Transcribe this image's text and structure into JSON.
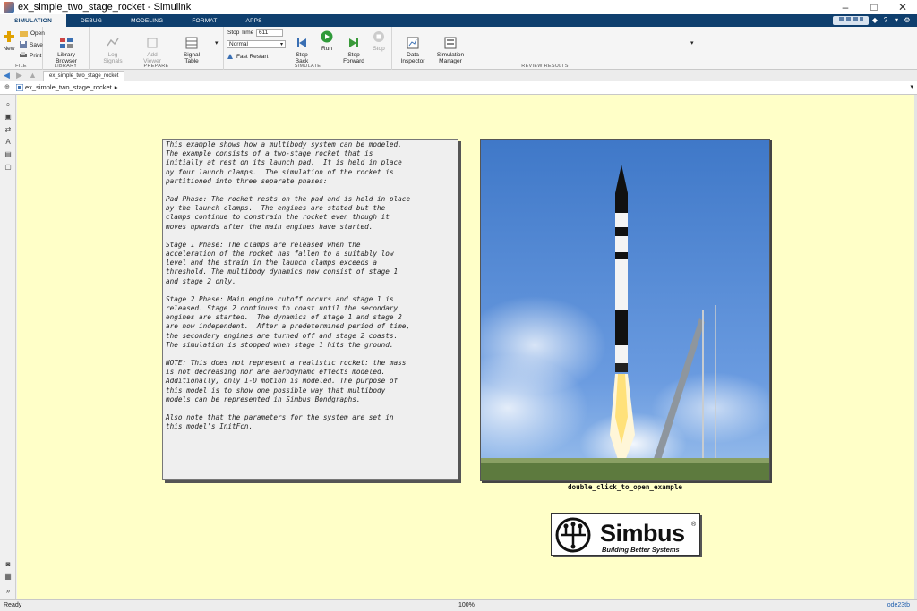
{
  "window": {
    "title": "ex_simple_two_stage_rocket - Simulink",
    "controls": [
      "–",
      "□",
      "✕"
    ]
  },
  "ribbon_tabs": [
    "SIMULATION",
    "DEBUG",
    "MODELING",
    "FORMAT",
    "APPS"
  ],
  "quick_access": {
    "search_label": "",
    "buttons": [
      "◆",
      "?",
      "▾",
      "⚙"
    ]
  },
  "ribbon": {
    "file": {
      "label": "FILE",
      "new_label": "New",
      "open_label": "Open",
      "save_label": "Save",
      "print_label": "Print"
    },
    "library": {
      "label": "LIBRARY",
      "library_browser_label": "Library\nBrowser"
    },
    "prepare": {
      "label": "PREPARE",
      "log_signals_label": "Log\nSignals",
      "add_viewer_label": "Add\nViewer",
      "signal_table_label": "Signal\nTable"
    },
    "simulate": {
      "label": "SIMULATE",
      "stop_time_label": "Stop Time",
      "stop_time_value": "611",
      "mode_value": "Normal",
      "fast_restart_label": "Fast Restart",
      "step_back_label": "Step\nBack",
      "run_label": "Run",
      "step_forward_label": "Step\nForward",
      "stop_label": "Stop"
    },
    "review": {
      "label": "REVIEW RESULTS",
      "data_inspector_label": "Data\nInspector",
      "sim_manager_label": "Simulation\nManager"
    }
  },
  "document_tab": "ex_simple_two_stage_rocket",
  "address": {
    "model_name": "ex_simple_two_stage_rocket",
    "arrow": "▸"
  },
  "annotation_paragraphs": [
    "This example shows how a multibody system can be modeled.\nThe example consists of a two-stage rocket that is\ninitially at rest on its launch pad.  It is held in place\nby four launch clamps.  The simulation of the rocket is\npartitioned into three separate phases:",
    "Pad Phase: The rocket rests on the pad and is held in place\nby the launch clamps.  The engines are stated but the\nclamps continue to constrain the rocket even though it\nmoves upwards after the main engines have started.",
    "Stage 1 Phase: The clamps are released when the\nacceleration of the rocket has fallen to a suitably low\nlevel and the strain in the launch clamps exceeds a\nthreshold. The multibody dynamics now consist of stage 1\nand stage 2 only.",
    "Stage 2 Phase: Main engine cutoff occurs and stage 1 is\nreleased. Stage 2 continues to coast until the secondary\nengines are started.  The dynamics of stage 1 and stage 2\nare now independent.  After a predetermined period of time,\nthe secondary engines are turned off and stage 2 coasts.\nThe simulation is stopped when stage 1 hits the ground.",
    "NOTE: This does not represent a realistic rocket: the mass\nis not decreasing nor are aerodynamc effects modeled.\nAdditionally, only 1-D motion is modeled. The purpose of\nthis model is to show one possible way that multibody\nmodels can be represented in Simbus Bondgraphs.",
    "Also note that the parameters for the system are set in\nthis model's InitFcn."
  ],
  "image_caption": "double_click_to_open_example",
  "logo": {
    "name": "Simbus",
    "registered": "®",
    "tagline": "Building Better Systems"
  },
  "status": {
    "left": "Ready",
    "zoom": "100%",
    "solver": "ode23tb"
  },
  "colors": {
    "ribbon_tab_bg": "#0f3f6e",
    "canvas_bg": "#ffffc8",
    "annotation_bg": "#efefef",
    "solver_text": "#1f5fae"
  }
}
